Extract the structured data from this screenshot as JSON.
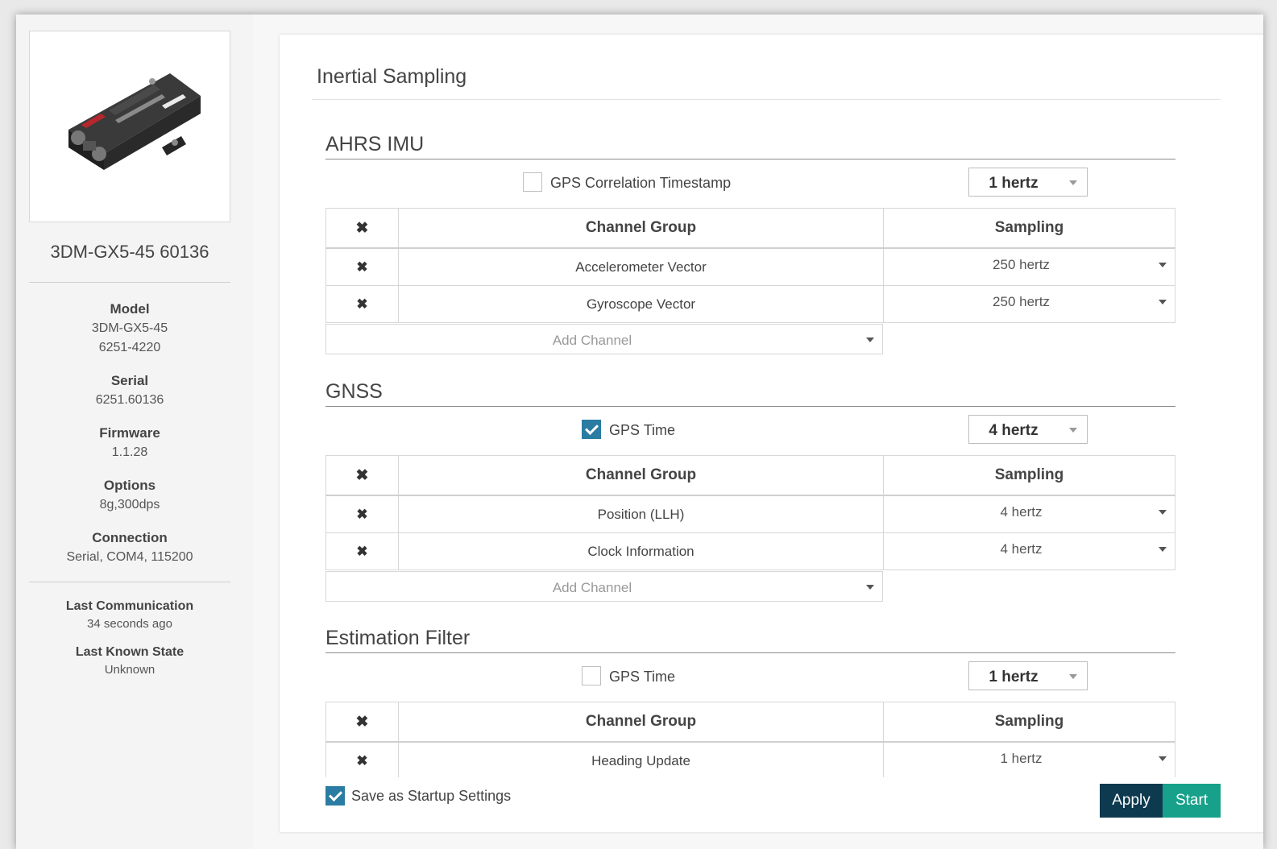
{
  "device": {
    "name": "3DM-GX5-45 60136",
    "model_label": "Model",
    "model_value_1": "3DM-GX5-45",
    "model_value_2": "6251-4220",
    "serial_label": "Serial",
    "serial_value": "6251.60136",
    "firmware_label": "Firmware",
    "firmware_value": "1.1.28",
    "options_label": "Options",
    "options_value": "8g,300dps",
    "connection_label": "Connection",
    "connection_value": "Serial, COM4, 115200",
    "last_comm_label": "Last Communication",
    "last_comm_value": "34 seconds ago",
    "last_state_label": "Last Known State",
    "last_state_value": "Unknown"
  },
  "page": {
    "title": "Inertial Sampling"
  },
  "table_headers": {
    "x": "✖",
    "group": "Channel Group",
    "sampling": "Sampling"
  },
  "add_channel_placeholder": "Add Channel",
  "sections": {
    "ahrs": {
      "title": "AHRS IMU",
      "option_label": "GPS Correlation Timestamp",
      "option_checked": false,
      "rate": "1 hertz",
      "rows": [
        {
          "x": "✖",
          "group": "Accelerometer Vector",
          "rate": "250 hertz"
        },
        {
          "x": "✖",
          "group": "Gyroscope Vector",
          "rate": "250 hertz"
        }
      ]
    },
    "gnss": {
      "title": "GNSS",
      "option_label": "GPS Time",
      "option_checked": true,
      "rate": "4 hertz",
      "rows": [
        {
          "x": "✖",
          "group": "Position (LLH)",
          "rate": "4 hertz"
        },
        {
          "x": "✖",
          "group": "Clock Information",
          "rate": "4 hertz"
        }
      ]
    },
    "filter": {
      "title": "Estimation Filter",
      "option_label": "GPS Time",
      "option_checked": false,
      "rate": "1 hertz",
      "rows": [
        {
          "x": "✖",
          "group": "Heading Update",
          "rate": "1 hertz"
        }
      ]
    }
  },
  "footer": {
    "save_startup_label": "Save as Startup Settings",
    "save_startup_checked": true,
    "apply_label": "Apply",
    "start_label": "Start"
  },
  "colors": {
    "accent": "#2b7ca3",
    "apply_bg": "#0e3a4f",
    "start_bg": "#17a18a"
  },
  "icons": {
    "remove": "close-x-icon",
    "dropdown": "caret-down-icon",
    "check": "checkmark-icon"
  }
}
